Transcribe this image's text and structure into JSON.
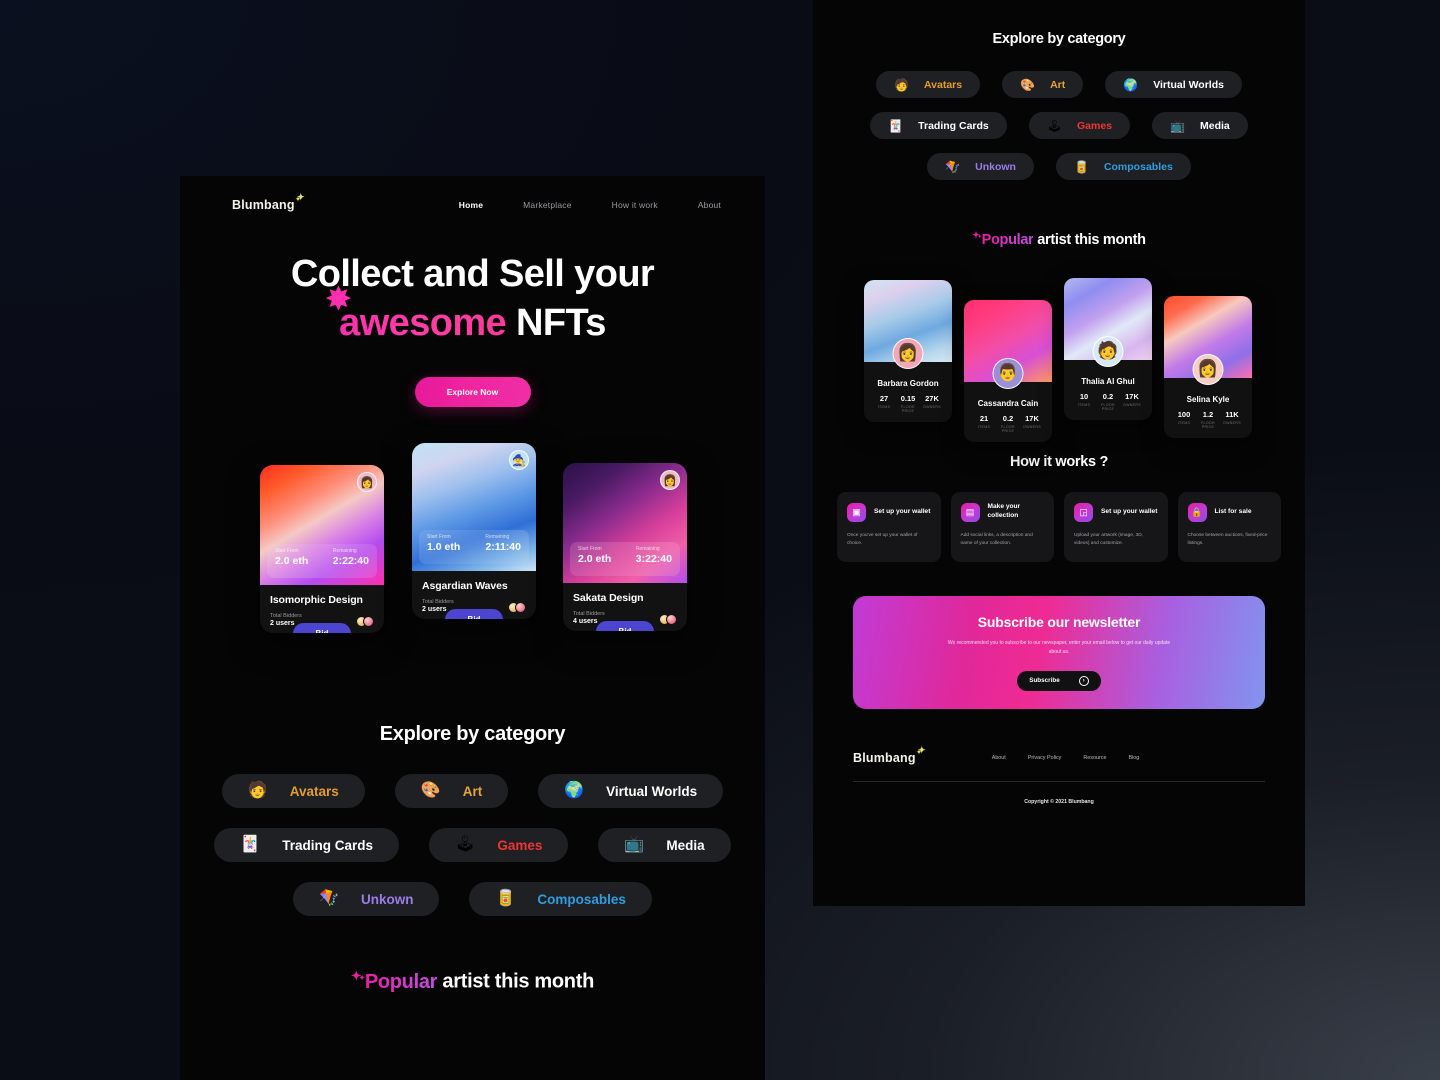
{
  "brand": {
    "name": "Blumbang"
  },
  "nav": {
    "items": [
      {
        "label": "Home",
        "active": true
      },
      {
        "label": "Marketplace",
        "active": false
      },
      {
        "label": "How it work",
        "active": false
      },
      {
        "label": "About",
        "active": false
      }
    ]
  },
  "hero": {
    "line1": "Collect and Sell your",
    "accent": "awesome",
    "line2_tail": " NFTs",
    "cta": "Explore Now"
  },
  "nft_labels": {
    "start_from": "Start From",
    "remaining": "Remaining",
    "total_bidders": "Total Bidders",
    "bid": "Bid"
  },
  "nfts": [
    {
      "title": "Isomorphic Design",
      "price": "2.0 eth",
      "remaining": "2:22:40",
      "bidders": "2 users"
    },
    {
      "title": "Asgardian Waves",
      "price": "1.0 eth",
      "remaining": "2:11:40",
      "bidders": "2 users"
    },
    {
      "title": "Sakata Design",
      "price": "2.0 eth",
      "remaining": "3:22:40",
      "bidders": "4 users"
    }
  ],
  "category": {
    "heading": "Explore by category",
    "items": [
      {
        "label": "Avatars",
        "emoji": "🧑",
        "color": "#e59b2e"
      },
      {
        "label": "Art",
        "emoji": "🎨",
        "color": "#e5a43a"
      },
      {
        "label": "Virtual Worlds",
        "emoji": "🌍",
        "color": "#ffffff"
      },
      {
        "label": "Trading Cards",
        "emoji": "🃏",
        "color": "#ffffff"
      },
      {
        "label": "Games",
        "emoji": "🕹",
        "color": "#ef3434"
      },
      {
        "label": "Media",
        "emoji": "📺",
        "color": "#ffffff"
      },
      {
        "label": "Unkown",
        "emoji": "🪁",
        "color": "#9b7de8"
      },
      {
        "label": "Composables",
        "emoji": "🥫",
        "color": "#2f9de0"
      }
    ]
  },
  "popular": {
    "accent": "Popular",
    "rest": " artist this month",
    "stat_labels": {
      "items": "ITEMS",
      "floor_price": "FLOOR PRICE",
      "owners": "OWNERS"
    },
    "artists": [
      {
        "name": "Barbara Gordon",
        "items": "27",
        "floor": "0.15",
        "owners": "27K",
        "emoji": "👩"
      },
      {
        "name": "Cassandra Cain",
        "items": "21",
        "floor": "0.2",
        "owners": "17K",
        "emoji": "👨"
      },
      {
        "name": "Thalia Al Ghul",
        "items": "10",
        "floor": "0.2",
        "owners": "17K",
        "emoji": "🧑"
      },
      {
        "name": "Selina Kyle",
        "items": "100",
        "floor": "1.2",
        "owners": "11K",
        "emoji": "👩"
      }
    ]
  },
  "how_it_works": {
    "heading": "How it works ?",
    "steps": [
      {
        "title": "Set up your wallet",
        "desc": "Once you've set up your wallet of choice.",
        "icon": "wallet-icon"
      },
      {
        "title": "Make your collection",
        "desc": "Add social links, a description and name of your collection.",
        "icon": "collection-icon"
      },
      {
        "title": "Set up your wallet",
        "desc": "Upload your artwork (image, 3D, videos) and customize.",
        "icon": "upload-icon"
      },
      {
        "title": "List for sale",
        "desc": "Choose between auctions, fixed-price listings.",
        "icon": "lock-icon"
      }
    ]
  },
  "newsletter": {
    "heading": "Subscribe our newsletter",
    "body": "We recommended you to subscribe to our newspaper, enter your email below to get our daily update about us.",
    "button": "Subscribe"
  },
  "footer": {
    "links": [
      "About",
      "Privacy Policy",
      "Resource",
      "Blog"
    ],
    "copyright": "Copyright © 2021 Blumbang"
  }
}
